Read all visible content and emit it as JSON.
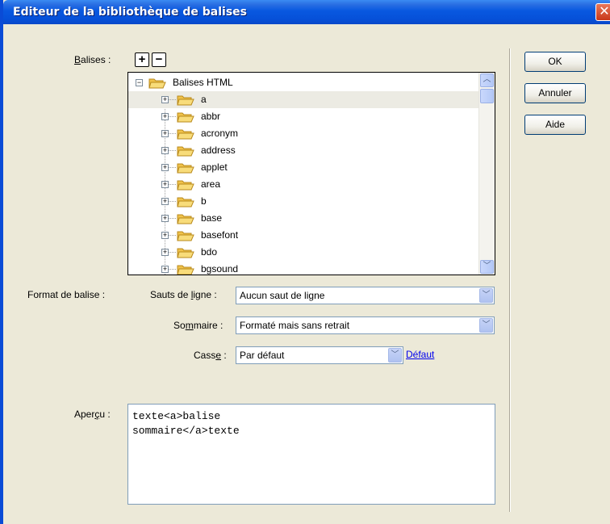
{
  "window": {
    "title": "Editeur de la bibliothèque de balises",
    "close_glyph": "✕"
  },
  "tags_label": {
    "mnemonic": "B",
    "rest": "alises :"
  },
  "tree": {
    "root_label": "Balises HTML",
    "items": [
      "a",
      "abbr",
      "acronym",
      "address",
      "applet",
      "area",
      "b",
      "base",
      "basefont",
      "bdo",
      "bgsound"
    ],
    "selected_index": 0
  },
  "format_label": "Format de balise :",
  "line_breaks": {
    "label_pre": "Sauts de ",
    "mnemonic": "l",
    "label_post": "igne :",
    "value": "Aucun saut de ligne"
  },
  "contents": {
    "label_pre": "So",
    "mnemonic": "m",
    "label_post": "maire :",
    "value": "Formaté mais sans retrait"
  },
  "case": {
    "label_pre": "Cass",
    "mnemonic": "e",
    "label_post": " :",
    "value": "Par défaut",
    "default_link": "Défaut"
  },
  "preview": {
    "label_pre": "Aper",
    "mnemonic": "ç",
    "label_post": "u :",
    "line1": "texte<a>balise",
    "line2": "sommaire</a>texte"
  },
  "buttons": {
    "ok": "OK",
    "cancel": "Annuler",
    "help": "Aide"
  },
  "colors": {
    "titlebar": "#0858e0",
    "dialog_bg": "#ece9d8",
    "link": "#0000ee",
    "selected_row": "#ecebe3"
  }
}
